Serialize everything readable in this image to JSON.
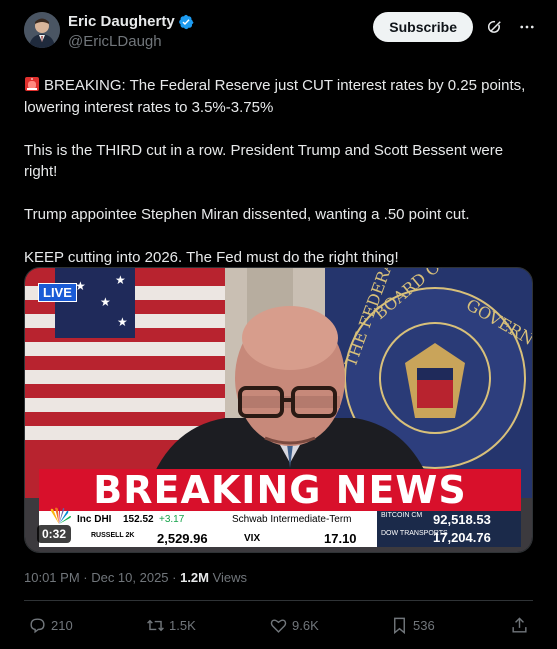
{
  "author": {
    "display_name": "Eric Daugherty",
    "handle": "@EricLDaugh",
    "verified": true
  },
  "header": {
    "subscribe_label": "Subscribe",
    "grok_icon": "grok-icon",
    "more_icon": "more-icon"
  },
  "tweet": {
    "paragraphs": [
      "BREAKING: The Federal Reserve just CUT interest rates by 0.25 points, lowering interest rates to 3.5%-3.75%",
      "This is the THIRD cut in a row. President Trump and Scott Bessent were right!",
      "Trump appointee Stephen Miran dissented, wanting a .50 point cut.",
      "KEEP cutting into 2026. The Fed must do the right thing!"
    ],
    "lead_emoji": "police-siren-icon"
  },
  "media": {
    "live_label": "LIVE",
    "banner": "BREAKING NEWS",
    "duration": "0:32",
    "ticker": {
      "item1_name": "Inc DHI",
      "item1_value": "152.52",
      "item1_change": "+3.17",
      "item2_name": "Schwab Intermediate-Term",
      "item3_name": "BITCOIN CM",
      "item3_value": "92,518.53",
      "item4_name": "RUSSELL 2K",
      "item4_value": "2,529.96",
      "item5_name": "VIX",
      "item5_value": "17.10",
      "item6_name": "DOW TRANSPORTS",
      "item6_value": "17,204.76"
    },
    "network_logo": "NBC peacock"
  },
  "meta": {
    "timestamp": "10:01 PM · Dec 10, 2025 · ",
    "views_count": "1.2M",
    "views_label": " Views"
  },
  "stats": {
    "replies": "210",
    "reposts": "1.5K",
    "likes": "9.6K",
    "bookmarks": "536"
  },
  "colors": {
    "background": "#000000",
    "text": "#e7e9ea",
    "muted": "#71767b",
    "verified": "#1d9bf0",
    "breaking_red": "#d8102b",
    "live_blue": "#1a5bd6"
  }
}
